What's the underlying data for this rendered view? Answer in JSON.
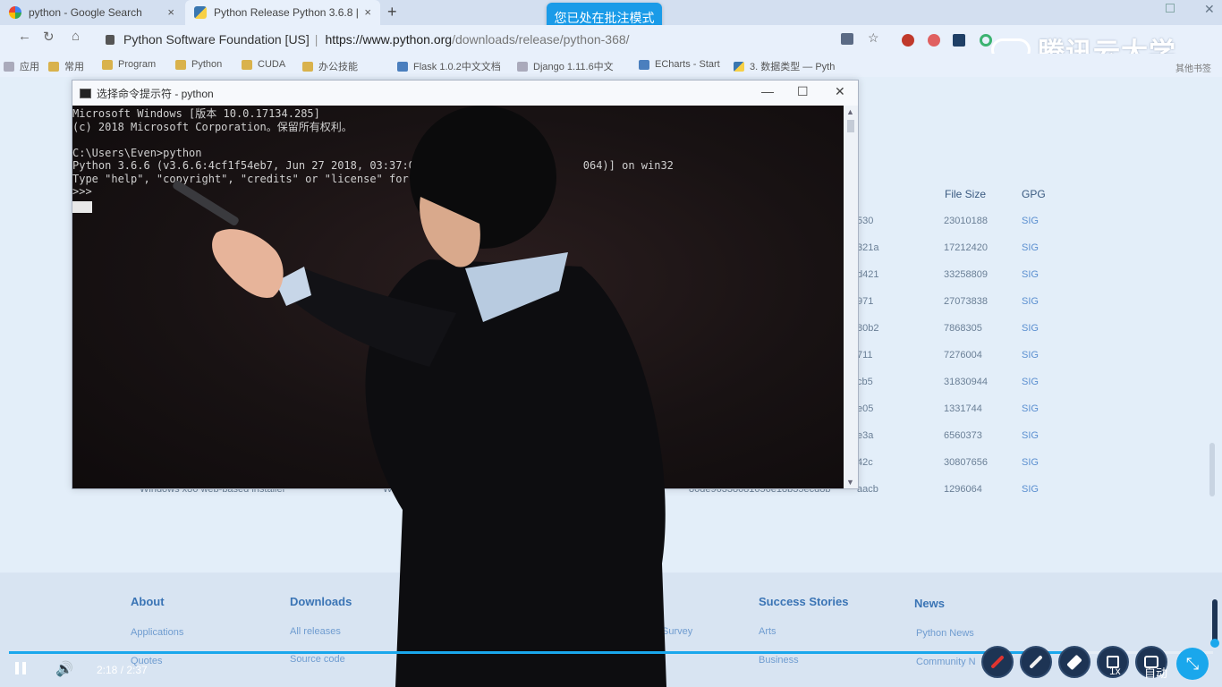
{
  "browser": {
    "tabs": [
      {
        "label": "python - Google Search",
        "close": "×"
      },
      {
        "label": "Python Release Python 3.6.8 |",
        "close": "×"
      }
    ],
    "new_tab": "+",
    "annotation_banner": "您已处在批注模式",
    "site_name": "Python Software Foundation [US]",
    "url_separator": "|",
    "url_host": "https://www.python.org",
    "url_path": "/downloads/release/python-368/",
    "watermark": "腾讯云大学",
    "bookmarks": [
      "应用",
      "常用",
      "Program",
      "Python",
      "CUDA",
      "办公技能",
      "Flask 1.0.2中文文档",
      "Django 1.11.6中文",
      "ECharts - Start",
      "3. 数据类型 — Pyth"
    ],
    "bookmarks_more": "其他书签"
  },
  "page": {
    "table_headers": {
      "file_size": "File Size",
      "gpg": "GPG"
    },
    "rows": [
      {
        "md5_tail": "530",
        "size": "23010188",
        "gpg": "SIG"
      },
      {
        "md5_tail": "321a",
        "size": "17212420",
        "gpg": "SIG"
      },
      {
        "md5_tail": "d421",
        "size": "33258809",
        "gpg": "SIG"
      },
      {
        "md5_tail": "971",
        "size": "27073838",
        "gpg": "SIG"
      },
      {
        "md5_tail": "80b2",
        "size": "7868305",
        "gpg": "SIG"
      },
      {
        "md5_tail": "711",
        "size": "7276004",
        "gpg": "SIG"
      },
      {
        "md5_tail": "cb5",
        "size": "31830944",
        "gpg": "SIG"
      },
      {
        "md5_tail": "e05",
        "size": "1331744",
        "gpg": "SIG"
      },
      {
        "md5_tail": "e3a",
        "size": "6560373",
        "gpg": "SIG"
      },
      {
        "md5_tail": "42c",
        "size": "30807656",
        "gpg": "SIG"
      },
      {
        "md5_tail": "aacb",
        "size": "1296064",
        "gpg": "SIG"
      }
    ],
    "last_row_name": "Windows x86 web-based installer",
    "last_row_os": "Wind",
    "last_row_md5": "80de96338681056e18b35ecd8b",
    "footer": {
      "about": {
        "title": "About",
        "links": [
          "Applications",
          "Quotes"
        ]
      },
      "downloads": {
        "title": "Downloads",
        "links": [
          "All releases",
          "Source code"
        ]
      },
      "survey": "Survey",
      "success": {
        "title": "Success Stories",
        "links": [
          "Arts",
          "Business"
        ]
      },
      "news": {
        "title": "News",
        "links": [
          "Python News",
          "Community N"
        ]
      }
    }
  },
  "cmd": {
    "title": "选择命令提示符 - python",
    "buttons": {
      "minimize": "—",
      "maximize": "☐",
      "close": "✕"
    },
    "lines": [
      "Microsoft Windows [版本 10.0.17134.285]",
      "(c) 2018 Microsoft Corporation。保留所有权利。",
      "",
      "C:\\Users\\Even>python",
      "Python 3.6.6 (v3.6.6:4cf1f54eb7, Jun 27 2018, 03:37:03                         064)] on win32",
      "Type \"help\", \"copyright\", \"credits\" or \"license\" for m",
      ">>>"
    ]
  },
  "player": {
    "time": "2:18 / 2:37",
    "progress": 0.879,
    "speed": "1x",
    "quality": "自动",
    "colors": {
      "accent": "#1aa7ec",
      "pen_red": "#e0342f"
    }
  }
}
